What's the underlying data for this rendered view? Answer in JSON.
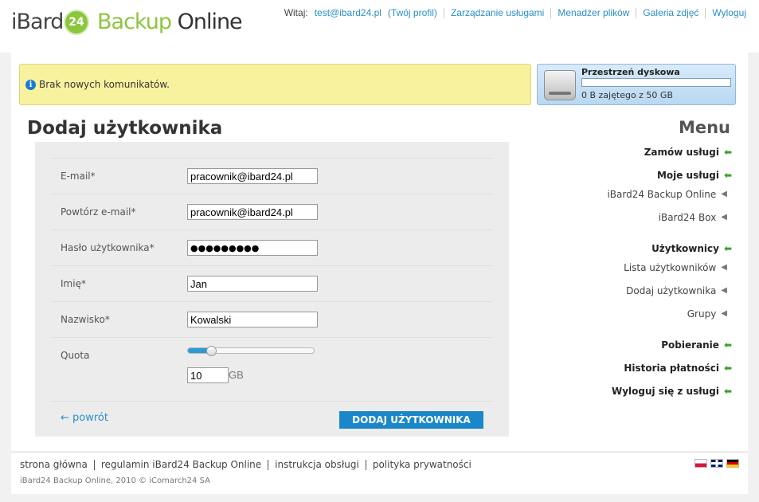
{
  "brand": {
    "part1": "iBard",
    "badge": "24",
    "part2": "Backup",
    "part3": "Online",
    "green": "#8cc63e"
  },
  "topnav": {
    "welcome": "Witaj:",
    "email": "test@ibard24.pl",
    "profile": "(Twój profil)",
    "links": [
      "Zarządzanie usługami",
      "Menadżer plików",
      "Galeria zdjęć",
      "Wyloguj"
    ]
  },
  "notice": {
    "icon": "info-icon",
    "text": "Brak nowych komunikatów."
  },
  "disk": {
    "title": "Przestrzeń dyskowa",
    "usage": "0 B zajętego z 50 GB",
    "used_fraction": 0
  },
  "page": {
    "title": "Dodaj użytkownika"
  },
  "form": {
    "email_label": "E-mail*",
    "email_value": "pracownik@ibard24.pl",
    "email_repeat_label": "Powtórz e-mail*",
    "email_repeat_value": "pracownik@ibard24.pl",
    "password_label": "Hasło użytkownika*",
    "password_value": "●●●●●●●●●",
    "firstname_label": "Imię*",
    "firstname_value": "Jan",
    "lastname_label": "Nazwisko*",
    "lastname_value": "Kowalski",
    "quota_label": "Quota",
    "quota_value": "10",
    "quota_unit": "GB",
    "quota_slider_fraction": 0.18,
    "back_label": "← powrót",
    "submit_label": "DODAJ UŻYTKOWNIKA",
    "accent": "#1a87c9"
  },
  "menu": {
    "title": "Menu",
    "items": [
      {
        "label": "Zamów usługi",
        "level": "main"
      },
      {
        "label": "Moje usługi",
        "level": "main"
      },
      {
        "label": "iBard24 Backup Online",
        "level": "sub"
      },
      {
        "label": "iBard24 Box",
        "level": "sub"
      },
      {
        "label": "Użytkownicy",
        "level": "main"
      },
      {
        "label": "Lista użytkowników",
        "level": "sub"
      },
      {
        "label": "Dodaj użytkownika",
        "level": "sub"
      },
      {
        "label": "Grupy",
        "level": "sub"
      },
      {
        "label": "Pobieranie",
        "level": "main"
      },
      {
        "label": "Historia płatności",
        "level": "main"
      },
      {
        "label": "Wyloguj się z usługi",
        "level": "main"
      }
    ]
  },
  "footer": {
    "links": [
      "strona główna",
      "regulamin iBard24 Backup Online",
      "instrukcja obsługi",
      "polityka prywatności"
    ],
    "copyright": "iBard24 Backup Online, 2010 © iComarch24 SA",
    "flags": [
      "flag-pl-icon",
      "flag-en-icon",
      "flag-de-icon"
    ]
  }
}
